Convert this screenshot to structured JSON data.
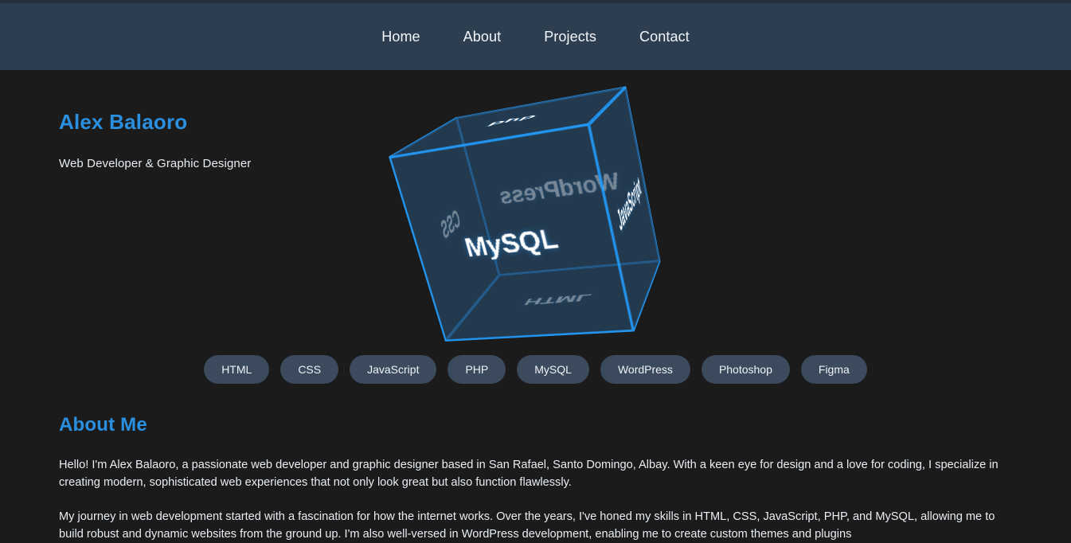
{
  "nav": {
    "items": [
      {
        "label": "Home"
      },
      {
        "label": "About"
      },
      {
        "label": "Projects"
      },
      {
        "label": "Contact"
      }
    ]
  },
  "hero": {
    "name": "Alex Balaoro",
    "tagline": "Web Developer & Graphic Designer"
  },
  "cube": {
    "faces": [
      {
        "label": "MySQL"
      },
      {
        "label": "php"
      },
      {
        "label": "JavaScript"
      },
      {
        "label": "CSS"
      },
      {
        "label": "HTML"
      },
      {
        "label": "WordPress"
      }
    ]
  },
  "skills": {
    "items": [
      {
        "label": "HTML"
      },
      {
        "label": "CSS"
      },
      {
        "label": "JavaScript"
      },
      {
        "label": "PHP"
      },
      {
        "label": "MySQL"
      },
      {
        "label": "WordPress"
      },
      {
        "label": "Photoshop"
      },
      {
        "label": "Figma"
      }
    ]
  },
  "about": {
    "title": "About Me",
    "paragraph1": "Hello! I'm Alex Balaoro, a passionate web developer and graphic designer based in San Rafael, Santo Domingo, Albay. With a keen eye for design and a love for coding, I specialize in creating modern, sophisticated web experiences that not only look great but also function flawlessly.",
    "paragraph2": "My journey in web development started with a fascination for how the internet works. Over the years, I've honed my skills in HTML, CSS, JavaScript, PHP, and MySQL, allowing me to build robust and dynamic websites from the ground up. I'm also well-versed in WordPress development, enabling me to create custom themes and plugins"
  },
  "colors": {
    "navbar": "#2d3e50",
    "page_background": "#1b1b1b",
    "accent_blue": "#2b8fe0",
    "cube_edge": "#2196f3",
    "pill_background": "#3b4a5c"
  }
}
